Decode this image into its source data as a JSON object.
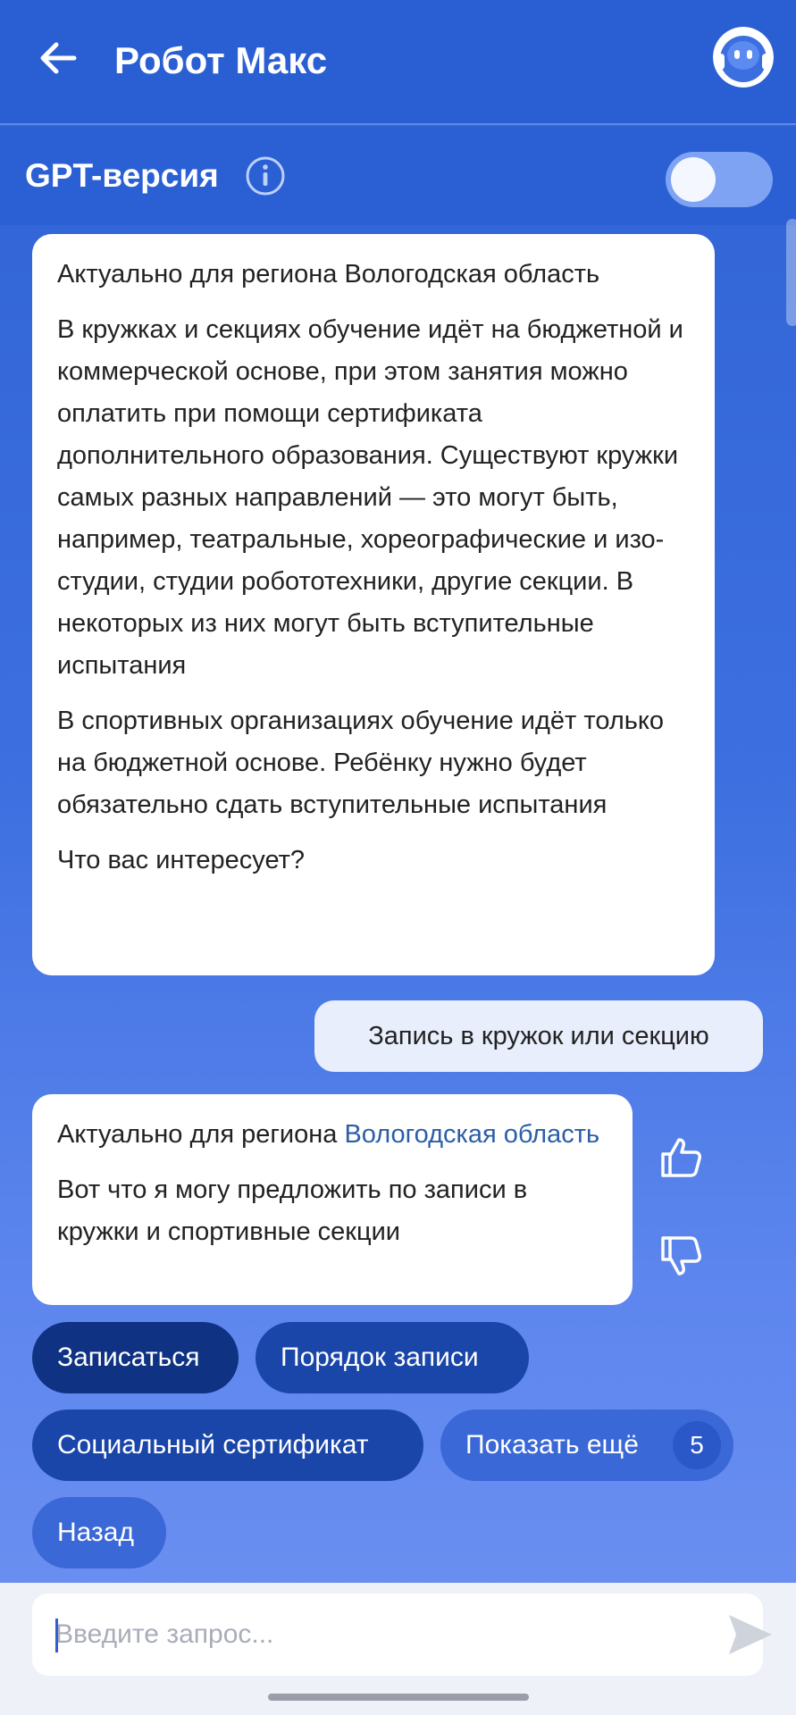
{
  "header": {
    "title": "Робот Макс"
  },
  "gpt_bar": {
    "label": "GPT-версия",
    "toggle_on": false
  },
  "messages": {
    "bot1": {
      "paragraphs": [
        "Актуально для региона Вологодская область",
        "В кружках и секциях обучение идёт на бюджетной и коммерческой основе, при этом занятия можно оплатить при помощи сертификата дополнительного образования. Существуют кружки самых разных направлений — это могут быть, например, театральные, хореографические и изо-студии, студии робототехники, другие секции. В некоторых из них могут быть вступительные испытания",
        "В спортивных организациях обучение идёт только на бюджетной основе. Ребёнку нужно будет обязательно сдать вступительные испытания",
        "Что вас интересует?"
      ]
    },
    "user1": "Запись в кружок или секцию",
    "bot2": {
      "region_prefix": "Актуально для региона ",
      "region_link": "Вологодская область",
      "text": "Вот что я могу предложить по записи в кружки и спортивные секции"
    }
  },
  "chips": {
    "signup": "Записаться",
    "order": "Порядок записи",
    "certificate": "Социальный сертификат",
    "show_more": "Показать ещё",
    "show_more_count": "5",
    "back": "Назад"
  },
  "input": {
    "value": "",
    "placeholder": "Введите запрос..."
  },
  "colors": {
    "header_bg": "#2a5fd3",
    "chip_primary": "#0f3382",
    "link": "#2c5ea8"
  },
  "icons": {
    "back": "arrow-left-icon",
    "avatar": "robot-avatar-icon",
    "info": "info-icon",
    "like": "thumbs-up-icon",
    "dislike": "thumbs-down-icon",
    "send": "send-icon"
  }
}
